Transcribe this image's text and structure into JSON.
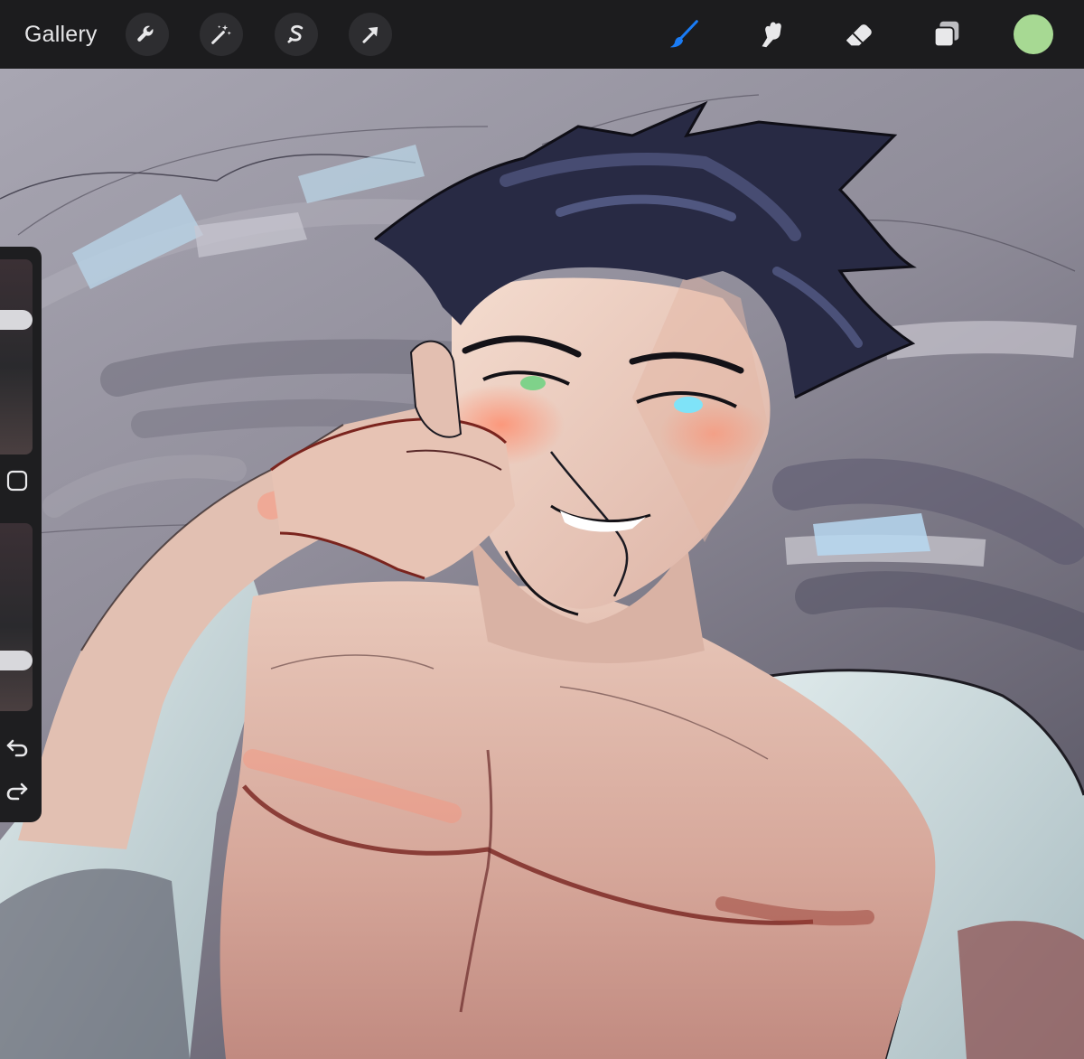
{
  "toolbar": {
    "gallery_label": "Gallery",
    "left_tools": [
      "wrench-icon",
      "magic-wand-icon",
      "selection-icon",
      "transform-arrow-icon"
    ],
    "right_tools": [
      "brush-icon",
      "smudge-icon",
      "eraser-icon",
      "layers-icon"
    ],
    "active_tool": "brush",
    "active_tool_color": "#1a7cf5",
    "current_color": "#a7d993"
  },
  "sidebar": {
    "brush_size_level": 0.71,
    "opacity_level": 0.24,
    "controls": [
      "brush-size-slider",
      "modify-button",
      "opacity-slider",
      "undo-icon",
      "redo-icon"
    ]
  },
  "canvas": {
    "background_color": "#8f8d99"
  }
}
